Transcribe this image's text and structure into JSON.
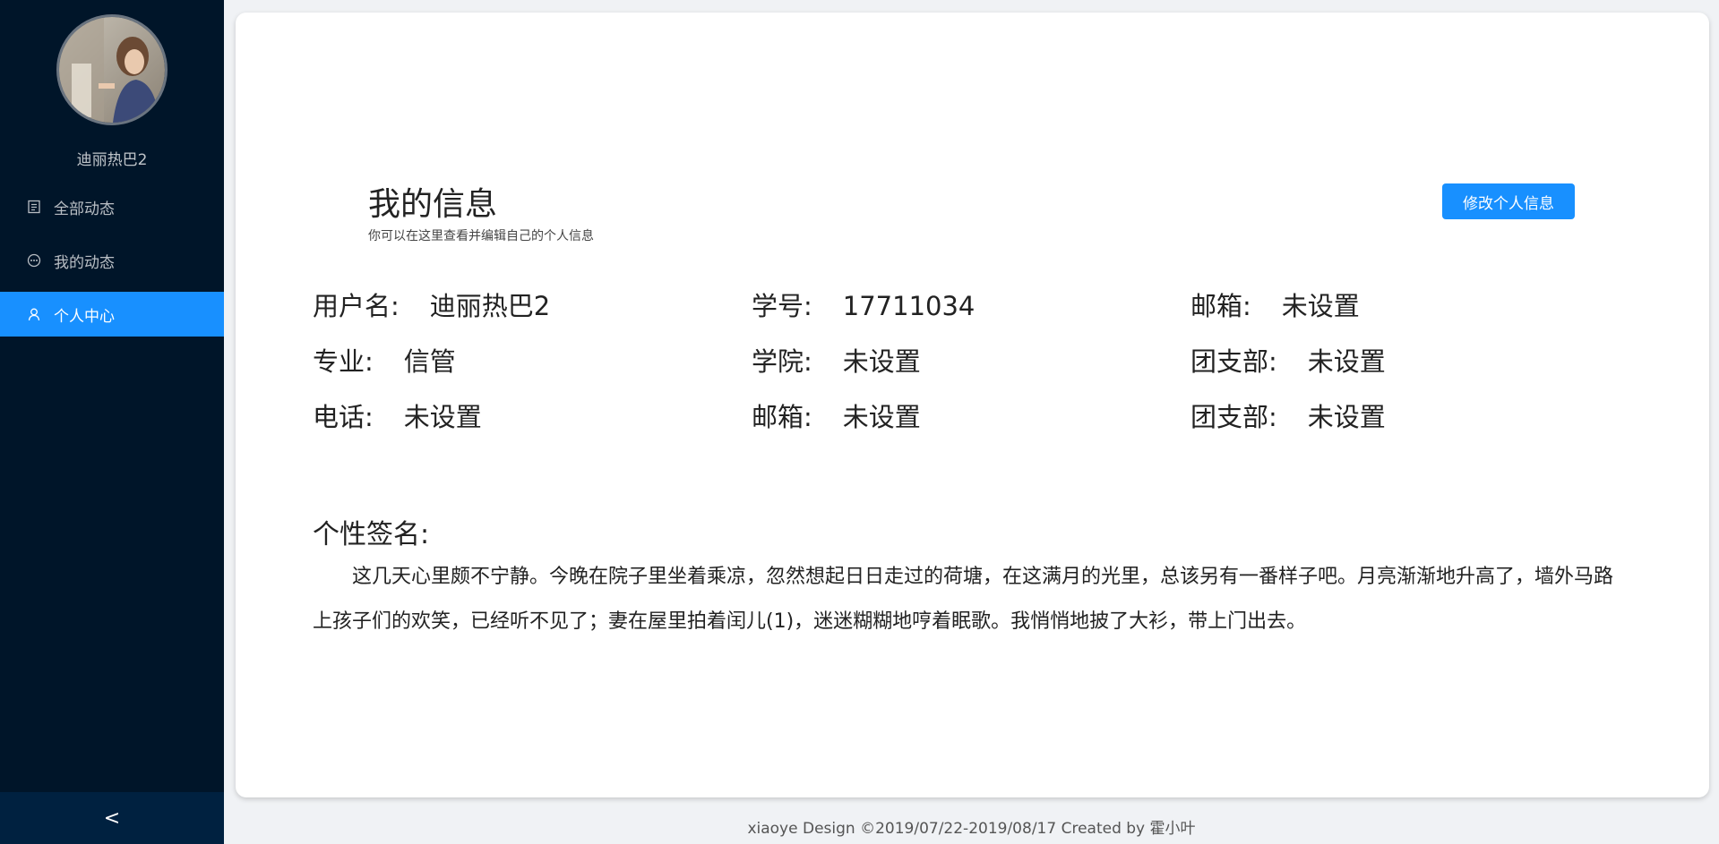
{
  "sidebar": {
    "username": "迪丽热巴2",
    "items": [
      {
        "label": "全部动态",
        "icon": "file-text-icon",
        "active": false
      },
      {
        "label": "我的动态",
        "icon": "message-icon",
        "active": false
      },
      {
        "label": "个人中心",
        "icon": "user-icon",
        "active": true
      }
    ],
    "collapse_label": "<"
  },
  "header": {
    "title": "我的信息",
    "subtitle": "你可以在这里查看并编辑自己的个人信息",
    "edit_button": "修改个人信息"
  },
  "info": [
    [
      {
        "label": "用户名:",
        "value": "迪丽热巴2"
      },
      {
        "label": "学号:",
        "value": "17711034"
      },
      {
        "label": "邮箱:",
        "value": "未设置"
      }
    ],
    [
      {
        "label": "专业:",
        "value": "信管"
      },
      {
        "label": "学院:",
        "value": "未设置"
      },
      {
        "label": "团支部:",
        "value": "未设置"
      }
    ],
    [
      {
        "label": "电话:",
        "value": "未设置"
      },
      {
        "label": "邮箱:",
        "value": "未设置"
      },
      {
        "label": "团支部:",
        "value": "未设置"
      }
    ]
  ],
  "signature": {
    "title": "个性签名:",
    "text": "这几天心里颇不宁静。今晚在院子里坐着乘凉，忽然想起日日走过的荷塘，在这满月的光里，总该另有一番样子吧。月亮渐渐地升高了，墙外马路上孩子们的欢笑，已经听不见了；妻在屋里拍着闰儿(1)，迷迷糊糊地哼着眠歌。我悄悄地披了大衫，带上门出去。"
  },
  "footer": "xiaoye Design ©2019/07/22-2019/08/17 Created by 霍小叶",
  "colors": {
    "sidebar": "#001529",
    "accent": "#1890ff"
  }
}
